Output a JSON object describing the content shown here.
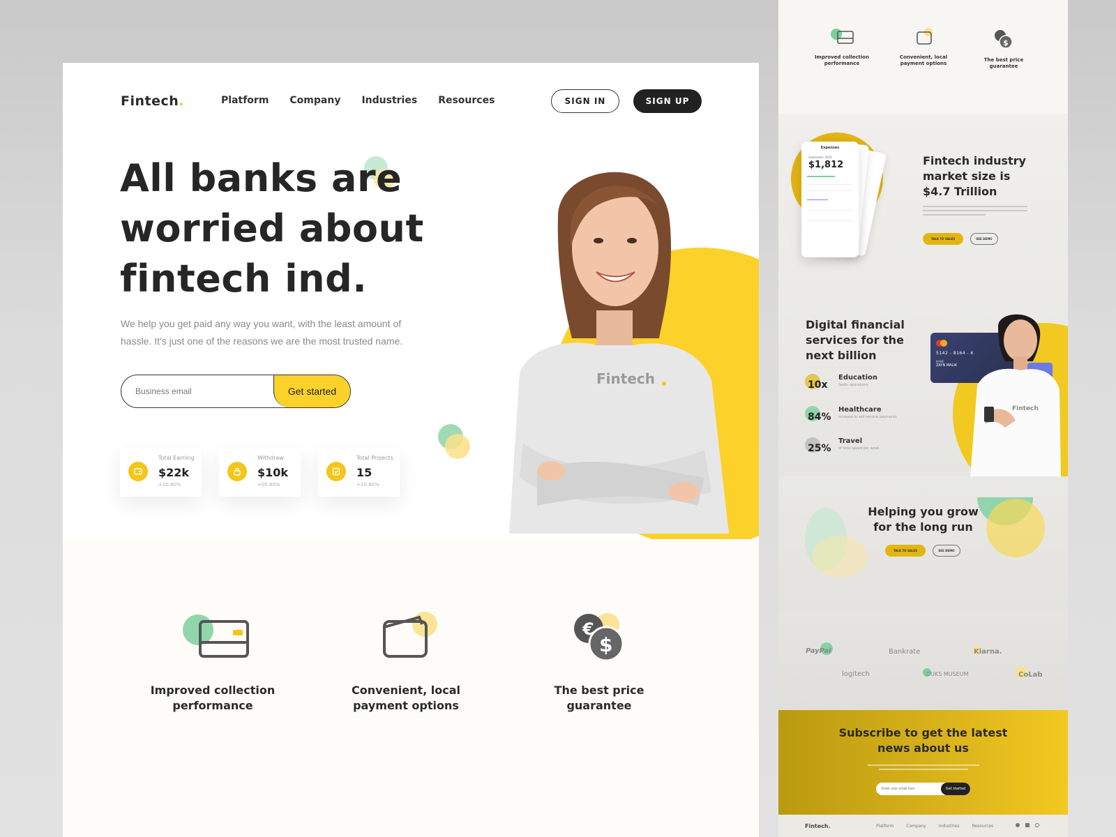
{
  "brand": {
    "name": "Fintech",
    "dot": ".",
    "accent": "#fcd12a",
    "green": "#7ccf9c"
  },
  "nav": {
    "items": [
      "Platform",
      "Company",
      "Industries",
      "Resources"
    ]
  },
  "auth": {
    "signin": "SIGN IN",
    "signup": "SIGN UP"
  },
  "hero": {
    "title_line1": "All banks are",
    "title_line2": "worried about",
    "title_line3": "fintech ind.",
    "subtitle_line1": "We help you get paid any way you want, with the least amount of",
    "subtitle_line2": "hassle. It's just one of the reasons we are the most trusted name.",
    "email_placeholder": "Business email",
    "cta": "Get started",
    "shirt_logo": "Fintech"
  },
  "stats": [
    {
      "label": "Total Earning",
      "value": "$22k",
      "delta": "+10.80%",
      "icon": "wallet-icon"
    },
    {
      "label": "Withdraw",
      "value": "$10k",
      "delta": "+05.80%",
      "icon": "lock-icon"
    },
    {
      "label": "Total Projects",
      "value": "15",
      "delta": "+10.80%",
      "icon": "checklist-icon"
    }
  ],
  "features": [
    {
      "title_line1": "Improved collection",
      "title_line2": "performance",
      "icon": "credit-card-icon"
    },
    {
      "title_line1": "Convenient, local",
      "title_line2": "payment options",
      "icon": "wallet-icon"
    },
    {
      "title_line1": "The best price",
      "title_line2": "guarantee",
      "icon": "currency-coins-icon"
    }
  ],
  "side": {
    "features": [
      {
        "line1": "Improved collection",
        "line2": "performance"
      },
      {
        "line1": "Convenient, local",
        "line2": "payment options"
      },
      {
        "line1": "The best price",
        "line2": "guarantee"
      }
    ],
    "market": {
      "title_line1": "Fintech industry",
      "title_line2": "market size is",
      "title_line3": "$4.7 Trillion",
      "talk": "TALK TO SALES",
      "demo": "SEE DEMO",
      "phone_header": "Expenses",
      "phone_month": "September 2020",
      "phone_amount": "$1,812"
    },
    "digital": {
      "title_line1": "Digital financial",
      "title_line2": "services for the",
      "title_line3": "next billion",
      "stats": [
        {
          "num": "10x",
          "name": "Education",
          "desc": "faster operations"
        },
        {
          "num": "84%",
          "name": "Healthcare",
          "desc": "increase in self service payments"
        },
        {
          "num": "25%",
          "name": "Travel",
          "desc": "of time saved per week"
        }
      ],
      "card_number": "5142 - 8164 - 6",
      "card_label": "NAME",
      "card_name": "ZAYN MALIK",
      "shirt_logo": "Fintech"
    },
    "grow": {
      "title_line1": "Helping you grow",
      "title_line2": "for the long run",
      "talk": "TALK TO SALES",
      "demo": "SEE DEMO"
    },
    "brands": [
      "PayPal",
      "Bankrate",
      "Klarna.",
      "logitech",
      "DUKS MUSEUM",
      "CoLab"
    ],
    "subscribe": {
      "title_line1": "Subscribe to get the latest",
      "title_line2": "news about us",
      "placeholder": "Enter your email here",
      "cta": "Get started"
    },
    "footer": {
      "logo": "Fintech.",
      "links": [
        "Platform",
        "Company",
        "Industries",
        "Resources"
      ]
    }
  }
}
